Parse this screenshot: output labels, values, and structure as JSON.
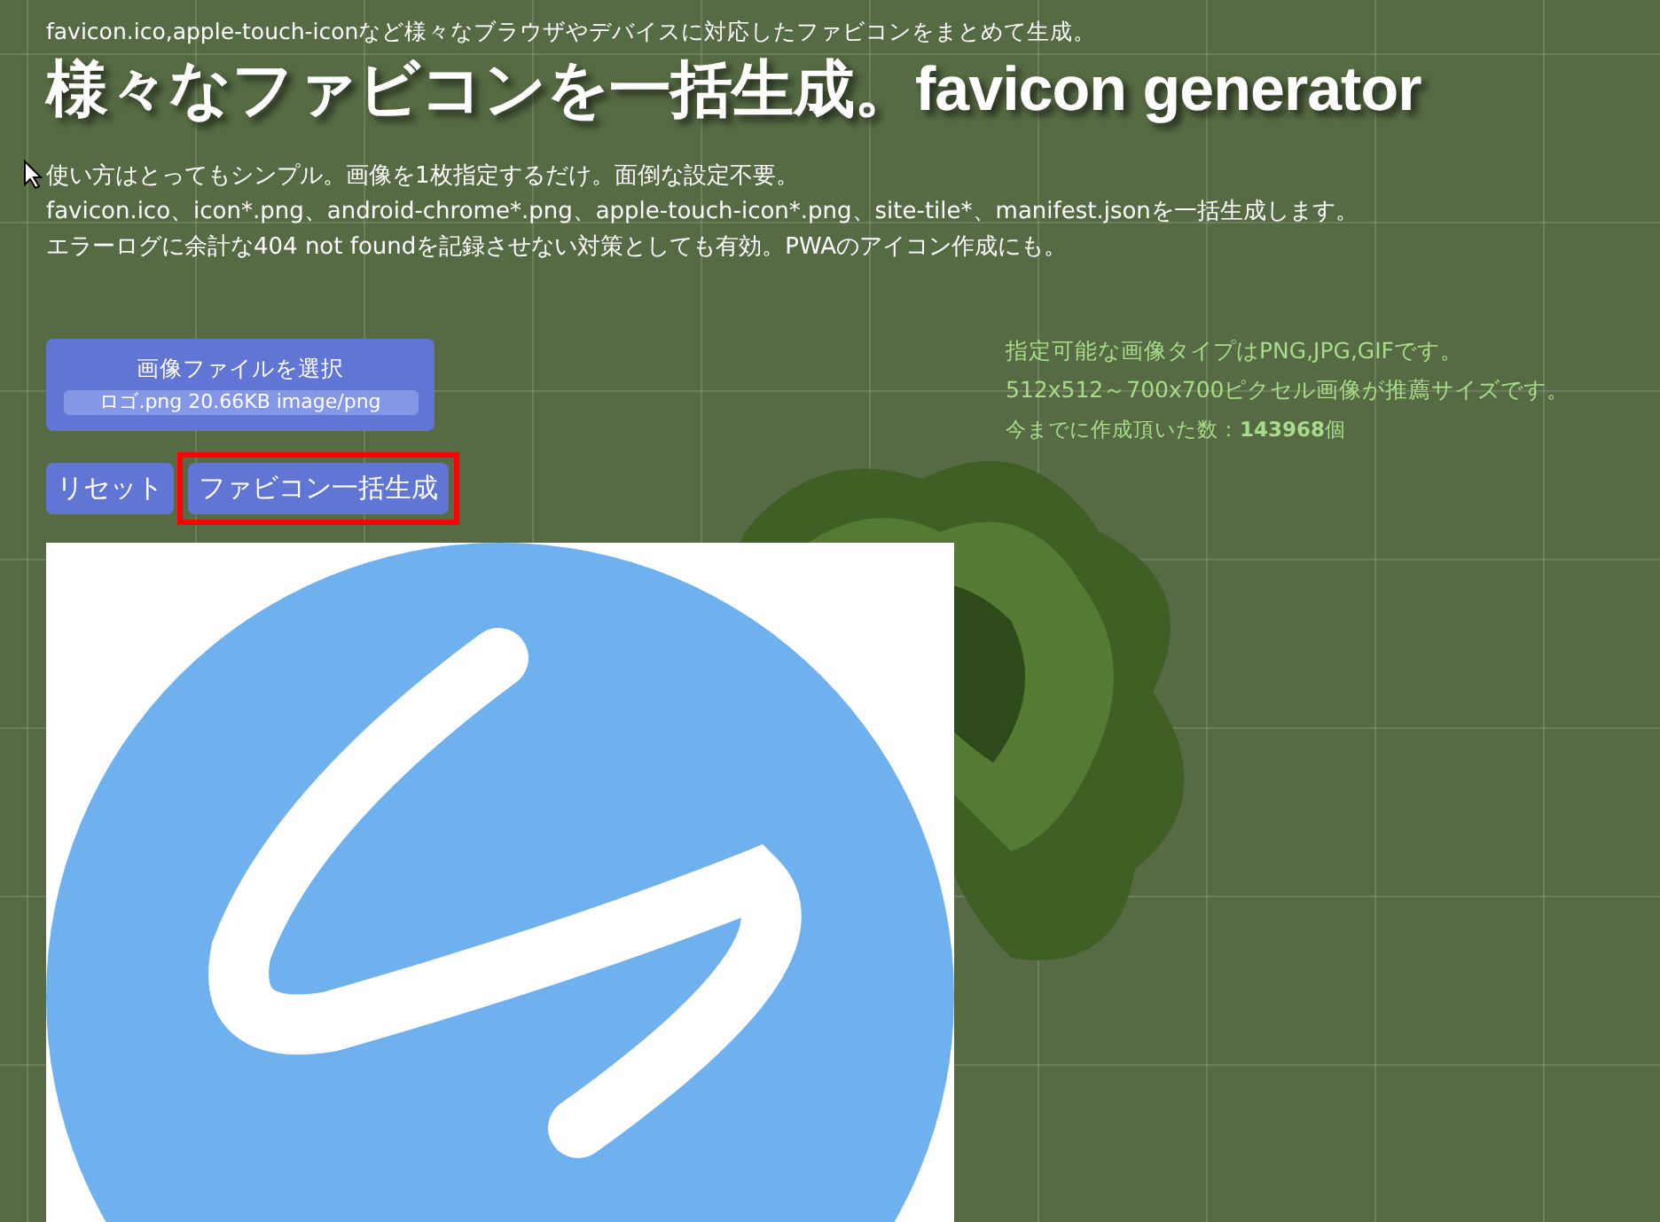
{
  "header": {
    "tagline": "favicon.ico,apple-touch-iconなど様々なブラウザやデバイスに対応したファビコンをまとめて生成。",
    "title": "様々なファビコンを一括生成。favicon generator"
  },
  "description": [
    "使い方はとってもシンプル。画像を1枚指定するだけ。面倒な設定不要。",
    "favicon.ico、icon*.png、android-chrome*.png、apple-touch-icon*.png、site-tile*、manifest.jsonを一括生成します。",
    "エラーログに余計な404 not foundを記録させない対策としても有効。PWAのアイコン作成にも。"
  ],
  "file_picker": {
    "label": "画像ファイルを選択",
    "file_info": "ロゴ.png 20.66KB image/png"
  },
  "buttons": [
    {
      "label": "リセット",
      "highlighted": false
    },
    {
      "label": "ファビコン一括生成",
      "highlighted": true
    }
  ],
  "notes": [
    "指定可能な画像タイプはPNG,JPG,GIFです。",
    "512x512～700x700ピクセル画像が推薦サイズです。"
  ],
  "counter": "今までに作成頂いた数：**143968**個"
}
